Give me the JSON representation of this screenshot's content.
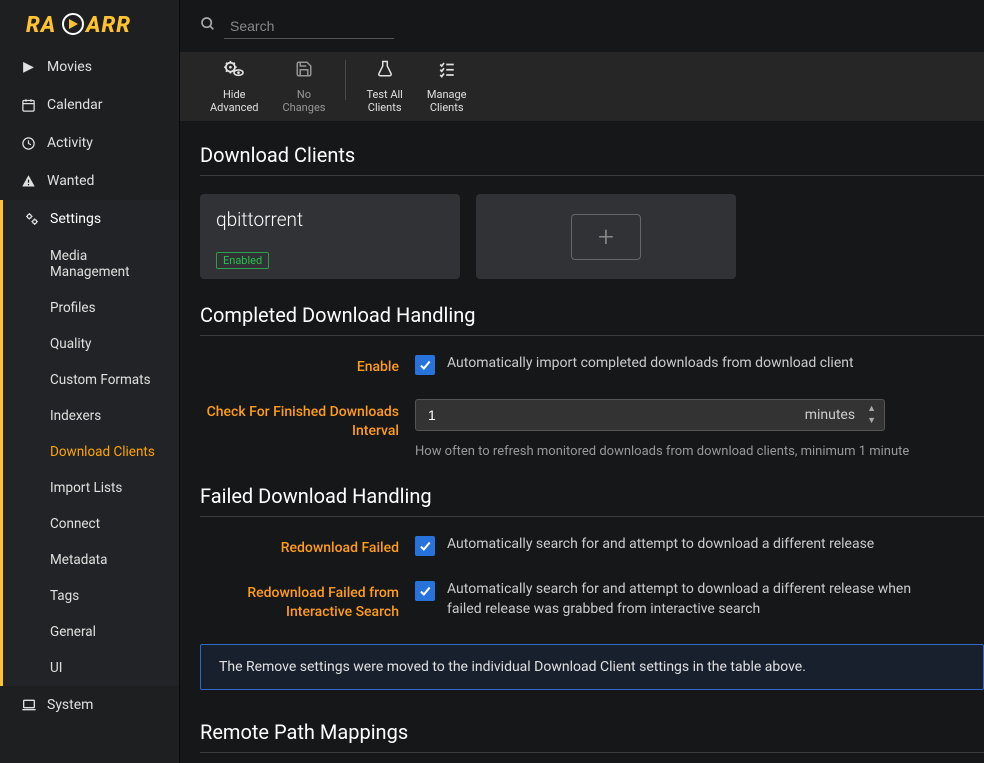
{
  "app": {
    "searchPlaceholder": "Search"
  },
  "sidebar": {
    "movies": "Movies",
    "calendar": "Calendar",
    "activity": "Activity",
    "wanted": "Wanted",
    "settings": "Settings",
    "system": "System",
    "sub": {
      "mediaManagement": "Media Management",
      "profiles": "Profiles",
      "quality": "Quality",
      "customFormats": "Custom Formats",
      "indexers": "Indexers",
      "downloadClients": "Download Clients",
      "importLists": "Import Lists",
      "connect": "Connect",
      "metadata": "Metadata",
      "tags": "Tags",
      "general": "General",
      "ui": "UI"
    }
  },
  "toolbar": {
    "hideAdvanced": {
      "l1": "Hide",
      "l2": "Advanced"
    },
    "noChanges": {
      "l1": "No",
      "l2": "Changes"
    },
    "testAll": {
      "l1": "Test All",
      "l2": "Clients"
    },
    "manage": {
      "l1": "Manage",
      "l2": "Clients"
    }
  },
  "sections": {
    "downloadClients": {
      "title": "Download Clients",
      "client1Name": "qbittorrent",
      "client1Status": "Enabled"
    },
    "completed": {
      "title": "Completed Download Handling",
      "enableLabel": "Enable",
      "enableDesc": "Automatically import completed downloads from download client",
      "intervalLabel": "Check For Finished Downloads Interval",
      "intervalValue": "1",
      "intervalUnit": "minutes",
      "intervalHelp": "How often to refresh monitored downloads from download clients, minimum 1 minute"
    },
    "failed": {
      "title": "Failed Download Handling",
      "redownloadLabel": "Redownload Failed",
      "redownloadDesc": "Automatically search for and attempt to download a different release",
      "interactiveLabel": "Redownload Failed from Interactive Search",
      "interactiveDesc": "Automatically search for and attempt to download a different release when failed release was grabbed from interactive search",
      "alert": "The Remove settings were moved to the individual Download Client settings in the table above."
    },
    "remote": {
      "title": "Remote Path Mappings"
    }
  }
}
